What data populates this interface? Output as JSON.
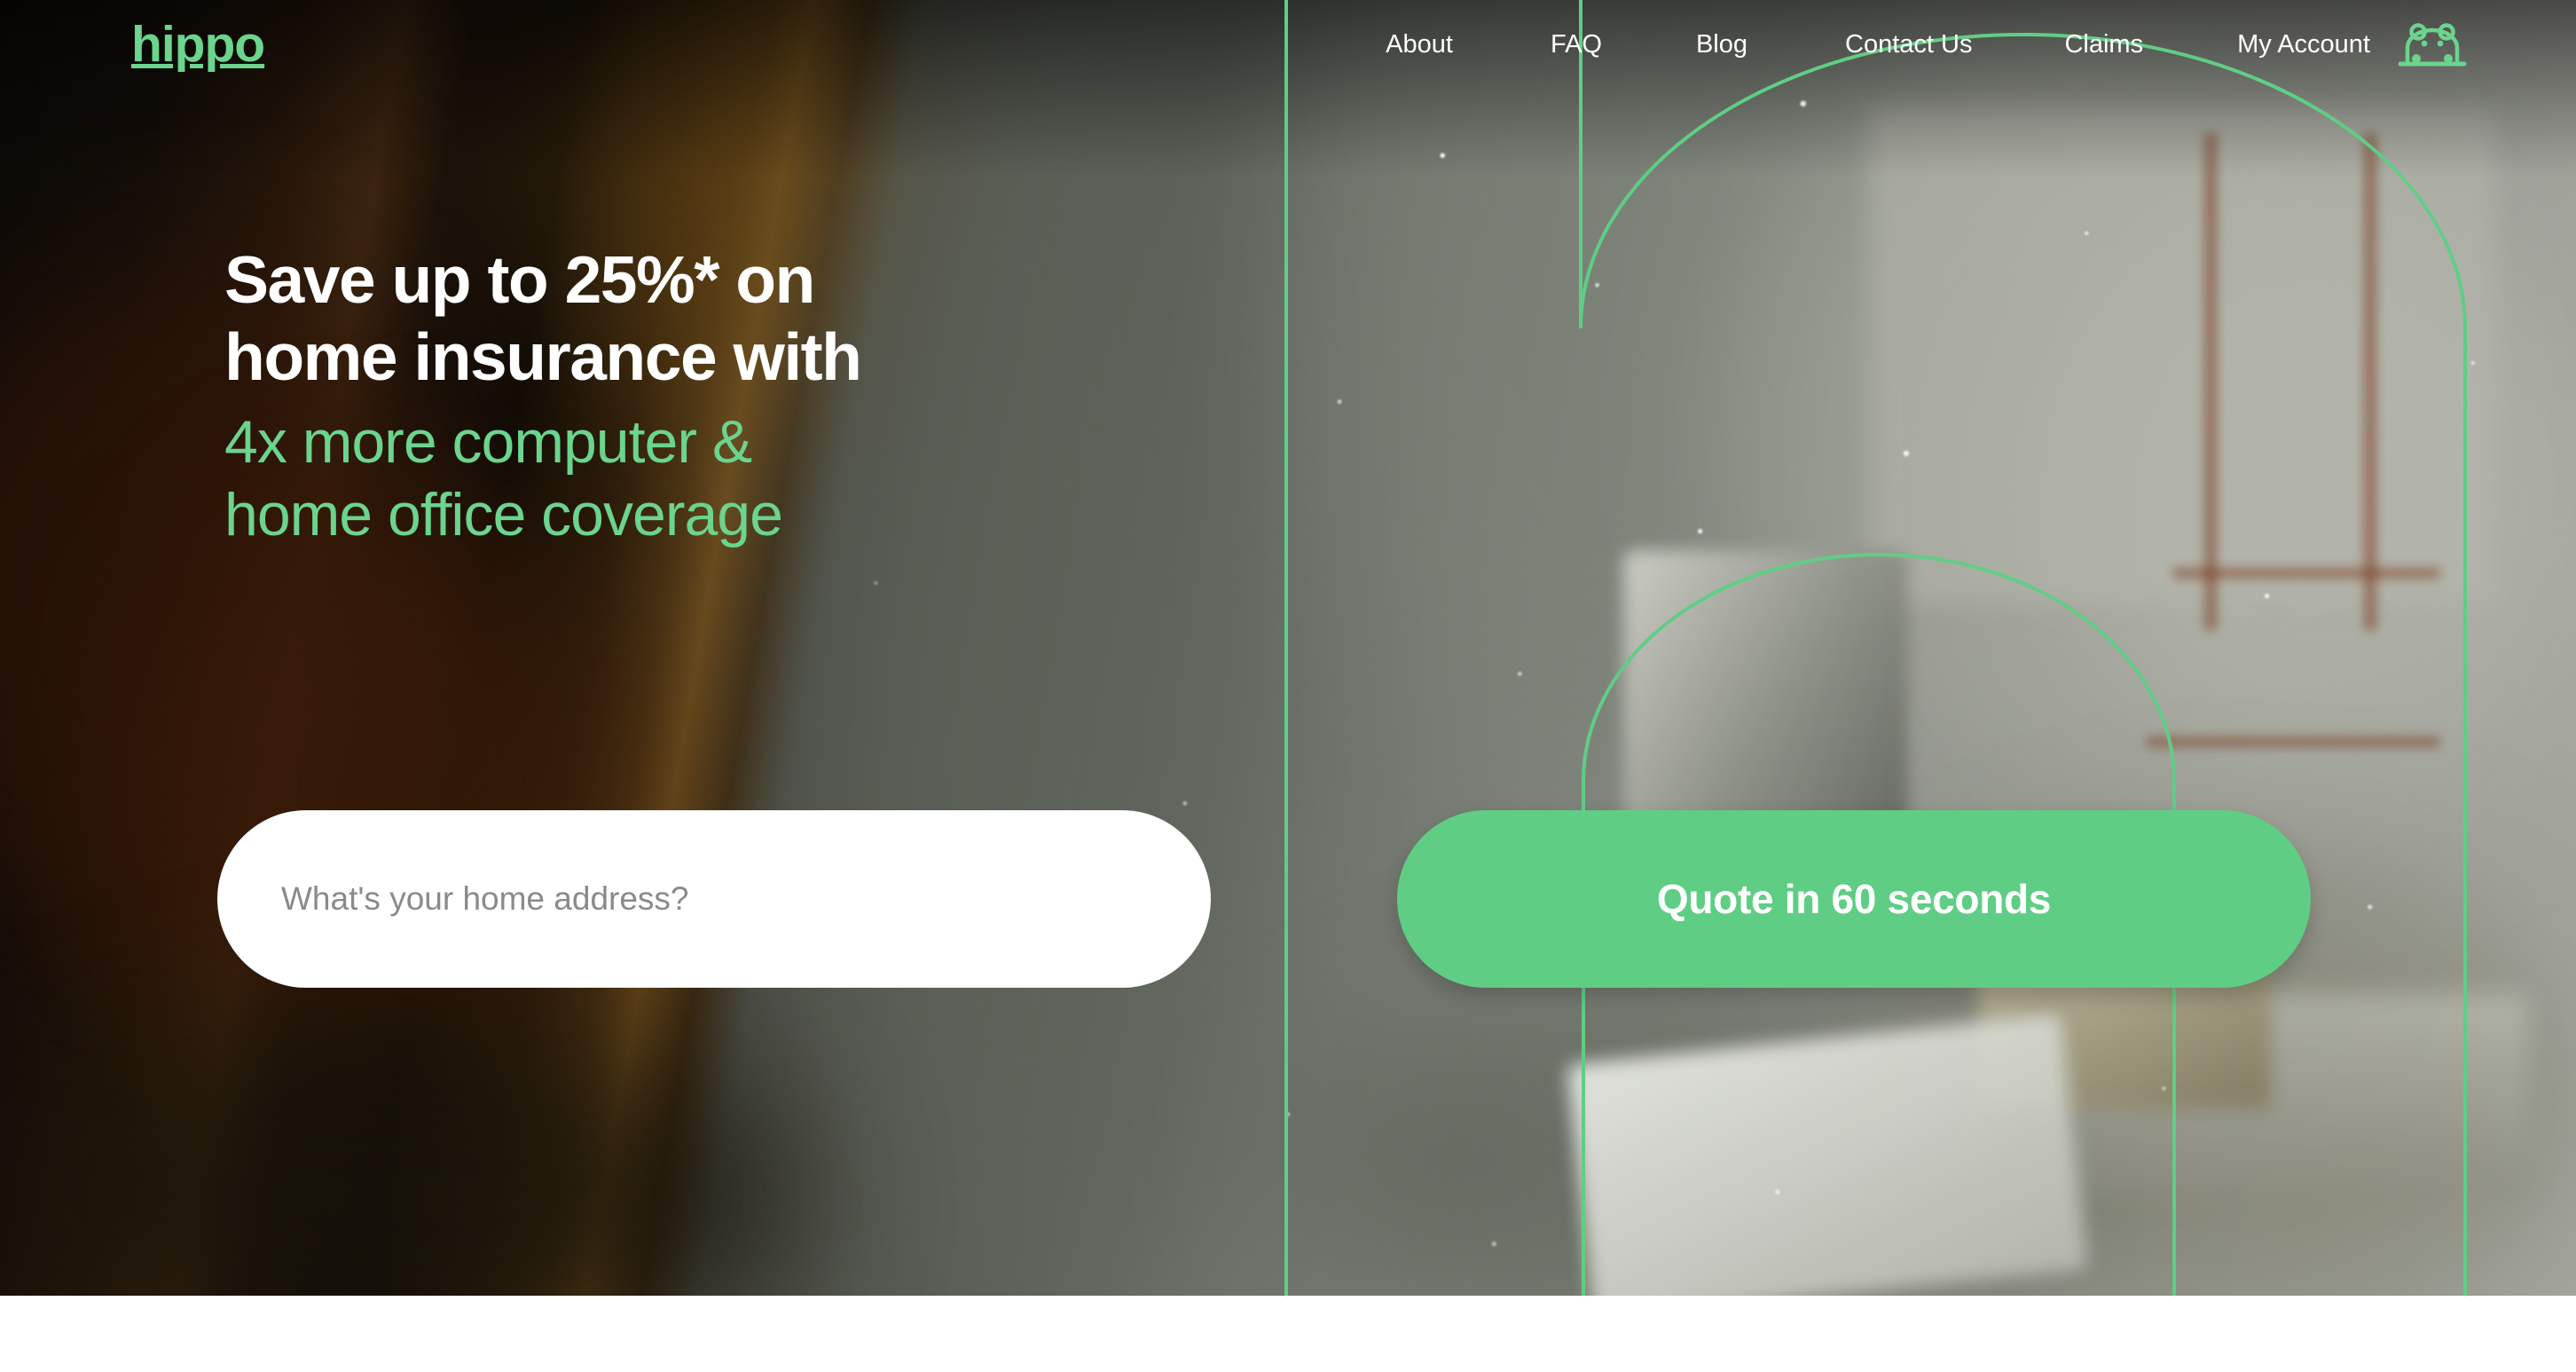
{
  "brand": {
    "logo_text": "hippo",
    "logo_color": "#6BD48D",
    "accent_green": "#5FCE84",
    "icon": "hippo-icon"
  },
  "nav": {
    "links": [
      {
        "label": "About",
        "name": "nav-link-about"
      },
      {
        "label": "FAQ",
        "name": "nav-link-faq"
      },
      {
        "label": "Blog",
        "name": "nav-link-blog"
      },
      {
        "label": "Contact Us",
        "name": "nav-link-contact-us"
      },
      {
        "label": "Claims",
        "name": "nav-link-claims"
      },
      {
        "label": "My Account",
        "name": "nav-link-my-account"
      }
    ]
  },
  "hero": {
    "headline_line1": "Save up to 25%* on",
    "headline_line2": "home insurance with",
    "subhead_line1": "4x more computer &",
    "subhead_line2": "home office coverage",
    "headline_color": "#FFFFFF",
    "subhead_color": "#6BD48D"
  },
  "search": {
    "placeholder": "What's your home address?",
    "value": "",
    "cta_label": "Quote in 60 seconds"
  },
  "decor": {
    "line_color": "#5FCE84",
    "shapes": [
      "vertical-rule",
      "outer-arch",
      "inner-arch"
    ]
  }
}
